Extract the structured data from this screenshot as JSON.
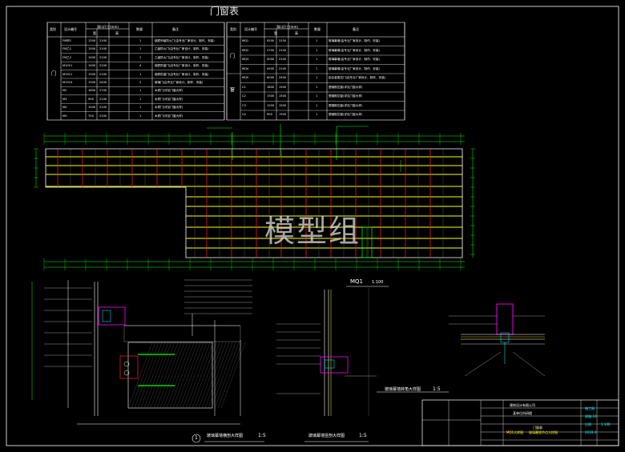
{
  "drawing": {
    "schedule_title": "门窗表",
    "schedule_headers": [
      "类别",
      "设计编号",
      "洞口尺寸(mm)",
      "数量",
      "备注"
    ],
    "schedule_subheaders": [
      "宽",
      "高"
    ],
    "left_category": "门",
    "right_category_1": "门",
    "right_category_2": "窗",
    "left_rows": [
      {
        "code": "FM甲1",
        "w": "1200",
        "h": "2100",
        "n": "1",
        "note": "钢质甲级防火门(由专业厂家设计、制作、安装)"
      },
      {
        "code": "FM乙1",
        "w": "1500",
        "h": "2100",
        "n": "1",
        "note": "乙级防火门(由专业厂家设计、制作、安装)"
      },
      {
        "code": "FM乙2",
        "w": "1000",
        "h": "2100",
        "n": "1",
        "note": "乙级防火门(由专业厂家设计、制作、安装)"
      },
      {
        "code": "M1021",
        "w": "1000",
        "h": "2100",
        "n": "4",
        "note": "钢质防盗门(由专业厂家设计、制作、安装)"
      },
      {
        "code": "M1521",
        "w": "1500",
        "h": "2100",
        "n": "1",
        "note": "钢质防盗门(由专业厂家设计、制作、安装)"
      },
      {
        "code": "M1524",
        "w": "1500",
        "h": "2400",
        "n": "2",
        "note": "玻璃门(由专业厂家设计、制作、安装)"
      },
      {
        "code": "M2",
        "w": "1800",
        "h": "2700",
        "n": "1",
        "note": "木质门(详见门窗大样)"
      },
      {
        "code": "M3",
        "w": "900",
        "h": "2100",
        "n": "1",
        "note": "木质门(详见门窗大样)"
      },
      {
        "code": "M4",
        "w": "1000",
        "h": "2100",
        "n": "1",
        "note": "木质门(详见门窗大样)"
      },
      {
        "code": "M5",
        "w": "700",
        "h": "2100",
        "n": "1",
        "note": "木质门(详见门窗大样)"
      }
    ],
    "right_rows": [
      {
        "code": "MQ1",
        "w": "9200",
        "h": "3150",
        "n": "1",
        "note": "玻璃幕墙(由专业厂家设计、制作、安装)"
      },
      {
        "code": "MQ2",
        "w": "2700",
        "h": "2100",
        "n": "1",
        "note": "玻璃幕墙(由专业厂家设计、制作、安装)"
      },
      {
        "code": "MQ3",
        "w": "3000",
        "h": "2100",
        "n": "1",
        "note": "玻璃幕墙(由专业厂家设计、制作、安装)"
      },
      {
        "code": "MQ4",
        "w": "4500",
        "h": "2100",
        "n": "1",
        "note": "玻璃幕墙(由专业厂家设计、制作、安装)"
      },
      {
        "code": "MQ5",
        "w": "6000",
        "h": "2400",
        "n": "1",
        "note": "铝合金推拉门(由专业厂家设计、制作、安装)"
      },
      {
        "code": "C1",
        "w": "1800",
        "h": "1500",
        "n": "1",
        "note": "塑钢推拉窗(详见门窗大样)"
      },
      {
        "code": "C2",
        "w": "1500",
        "h": "1500",
        "n": "1",
        "note": "塑钢推拉窗(详见门窗大样)"
      },
      {
        "code": "C3",
        "w": "1200",
        "h": "1500",
        "n": "1",
        "note": "塑钢推拉窗(详见门窗大样)"
      },
      {
        "code": "C4",
        "w": "900",
        "h": "1500",
        "n": "1",
        "note": "塑钢推拉窗(详见门窗大样)"
      }
    ],
    "elevation_label": "MQ1",
    "elevation_scale": "1:100",
    "watermark": "模型组",
    "detail_1_title": "玻璃幕墙横剖大样图",
    "detail_1_scale": "1:5",
    "detail_1_number": "1",
    "detail_2_title": "玻璃幕墙竖剖大样图",
    "detail_2_scale": "1:5",
    "detail_3_title": "玻璃幕墙转角大样图",
    "detail_3_scale": "1:5",
    "titleblock": {
      "company": "建筑设计有限公司",
      "project": "某单位科研楼",
      "drawing_name_1": "MQ1大样图",
      "drawing_name_2": "玻璃幕墙节点大样图",
      "drawing_name_3": "门窗表",
      "drawing_no": "建施-10",
      "scale_label": "比例",
      "scale_value": "1:100",
      "date": "2019.3",
      "phase": "施工图"
    },
    "colors": {
      "background": "#000000",
      "frame": "#ffffff",
      "yellow": "#ffff00",
      "green": "#00ff00",
      "red": "#ff0000",
      "cyan": "#00ffff",
      "magenta": "#ff00ff"
    }
  }
}
